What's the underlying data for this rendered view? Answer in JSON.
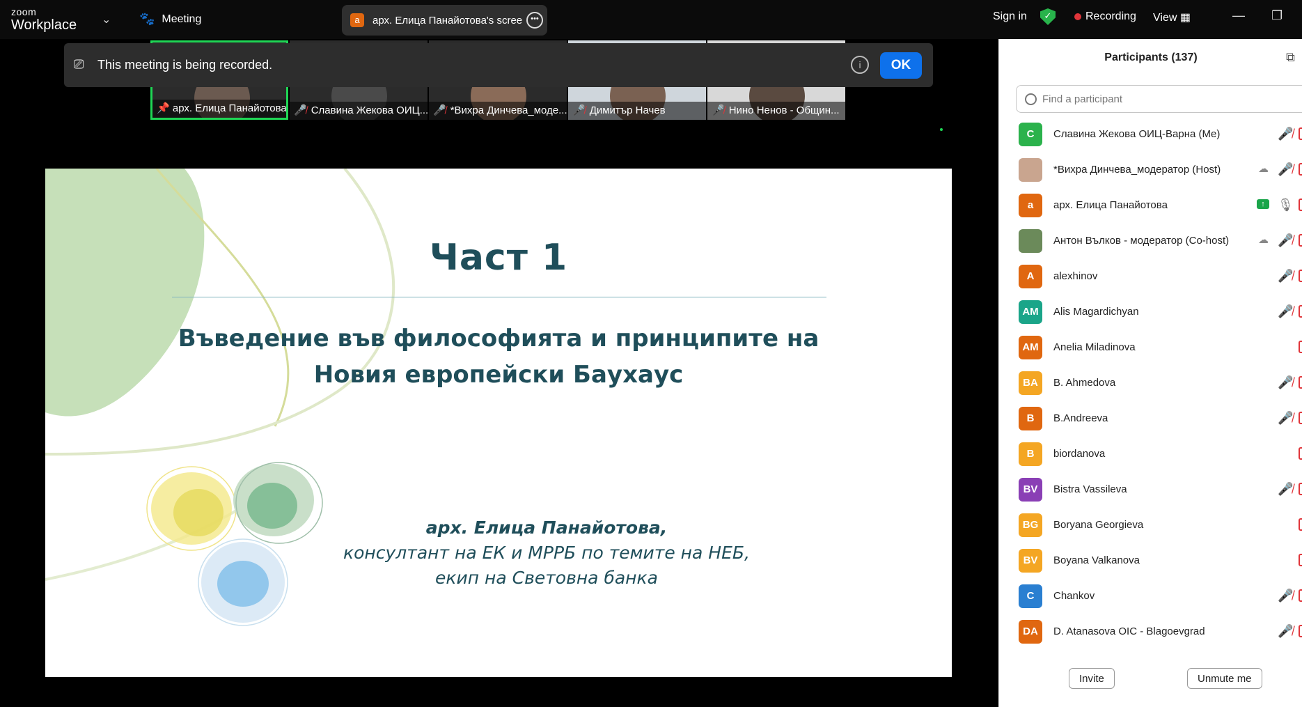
{
  "titlebar": {
    "logo_top": "zoom",
    "logo_bottom": "Workplace",
    "meeting_label": "Meeting",
    "share_avatar": "a",
    "share_title": "арх. Елица Панайотова's screen",
    "sign_in": "Sign in",
    "recording": "Recording",
    "view": "View"
  },
  "thumbnails": [
    {
      "name": "арх. Елица Панайотова",
      "muted": false,
      "active": true
    },
    {
      "name": "Славина Жекова ОИЦ...",
      "muted": true,
      "active": false
    },
    {
      "name": "*Вихра Динчева_моде...",
      "muted": true,
      "active": false
    },
    {
      "name": "Димитър Начев",
      "muted": true,
      "active": false
    },
    {
      "name": "Нино Ненов - Общин...",
      "muted": true,
      "active": false
    }
  ],
  "banner": {
    "message": "This meeting is being recorded.",
    "ok_label": "OK"
  },
  "slide": {
    "title": "Част 1",
    "subtitle_line1": "Въведение във философията и принципите на",
    "subtitle_line2": "Новия европейски Баухаус",
    "author": "арх. Елица Панайотова,",
    "role_line1": "консултант на ЕК и МРРБ по темите на НЕБ,",
    "role_line2": "екип на Световна банка"
  },
  "panel": {
    "title": "Participants (137)",
    "search_placeholder": "Find a participant",
    "participants": [
      {
        "initials": "С",
        "name": "Славина Жекова ОИЦ-Варна (Me)",
        "color": "#2bb24c",
        "muted": true
      },
      {
        "initials": "",
        "name": "*Вихра Динчева_модератор (Host)",
        "color": "#c9a58f",
        "muted": true,
        "photo": true,
        "extra": "cloud"
      },
      {
        "initials": "а",
        "name": "арх. Елица Панайотова",
        "color": "#e06710",
        "muted": false,
        "extra": "share"
      },
      {
        "initials": "",
        "name": "Антон Вълков - модератор (Co-host)",
        "color": "#6b8a5a",
        "muted": true,
        "photo": true,
        "extra": "cloud"
      },
      {
        "initials": "A",
        "name": "alexhinov",
        "color": "#e06710",
        "muted": true
      },
      {
        "initials": "AM",
        "name": "Alis Magardichyan",
        "color": "#1aa589",
        "muted": true
      },
      {
        "initials": "AM",
        "name": "Anelia Miladinova",
        "color": "#e06710",
        "muted": false
      },
      {
        "initials": "BA",
        "name": "B. Ahmedova",
        "color": "#f4a623",
        "muted": true
      },
      {
        "initials": "B",
        "name": "B.Andreeva",
        "color": "#e06710",
        "muted": true
      },
      {
        "initials": "B",
        "name": "biordanova",
        "color": "#f4a623",
        "muted": false
      },
      {
        "initials": "BV",
        "name": "Bistra Vassileva",
        "color": "#8a3fb5",
        "muted": true
      },
      {
        "initials": "BG",
        "name": "Boryana Georgieva",
        "color": "#f4a623",
        "muted": false
      },
      {
        "initials": "BV",
        "name": "Boyana Valkanova",
        "color": "#f4a623",
        "muted": false
      },
      {
        "initials": "C",
        "name": "Chankov",
        "color": "#2a7fd1",
        "muted": true
      },
      {
        "initials": "DA",
        "name": "D. Atanasova OIC - Blagoevgrad",
        "color": "#e06710",
        "muted": true
      }
    ],
    "invite": "Invite",
    "unmute": "Unmute me"
  }
}
